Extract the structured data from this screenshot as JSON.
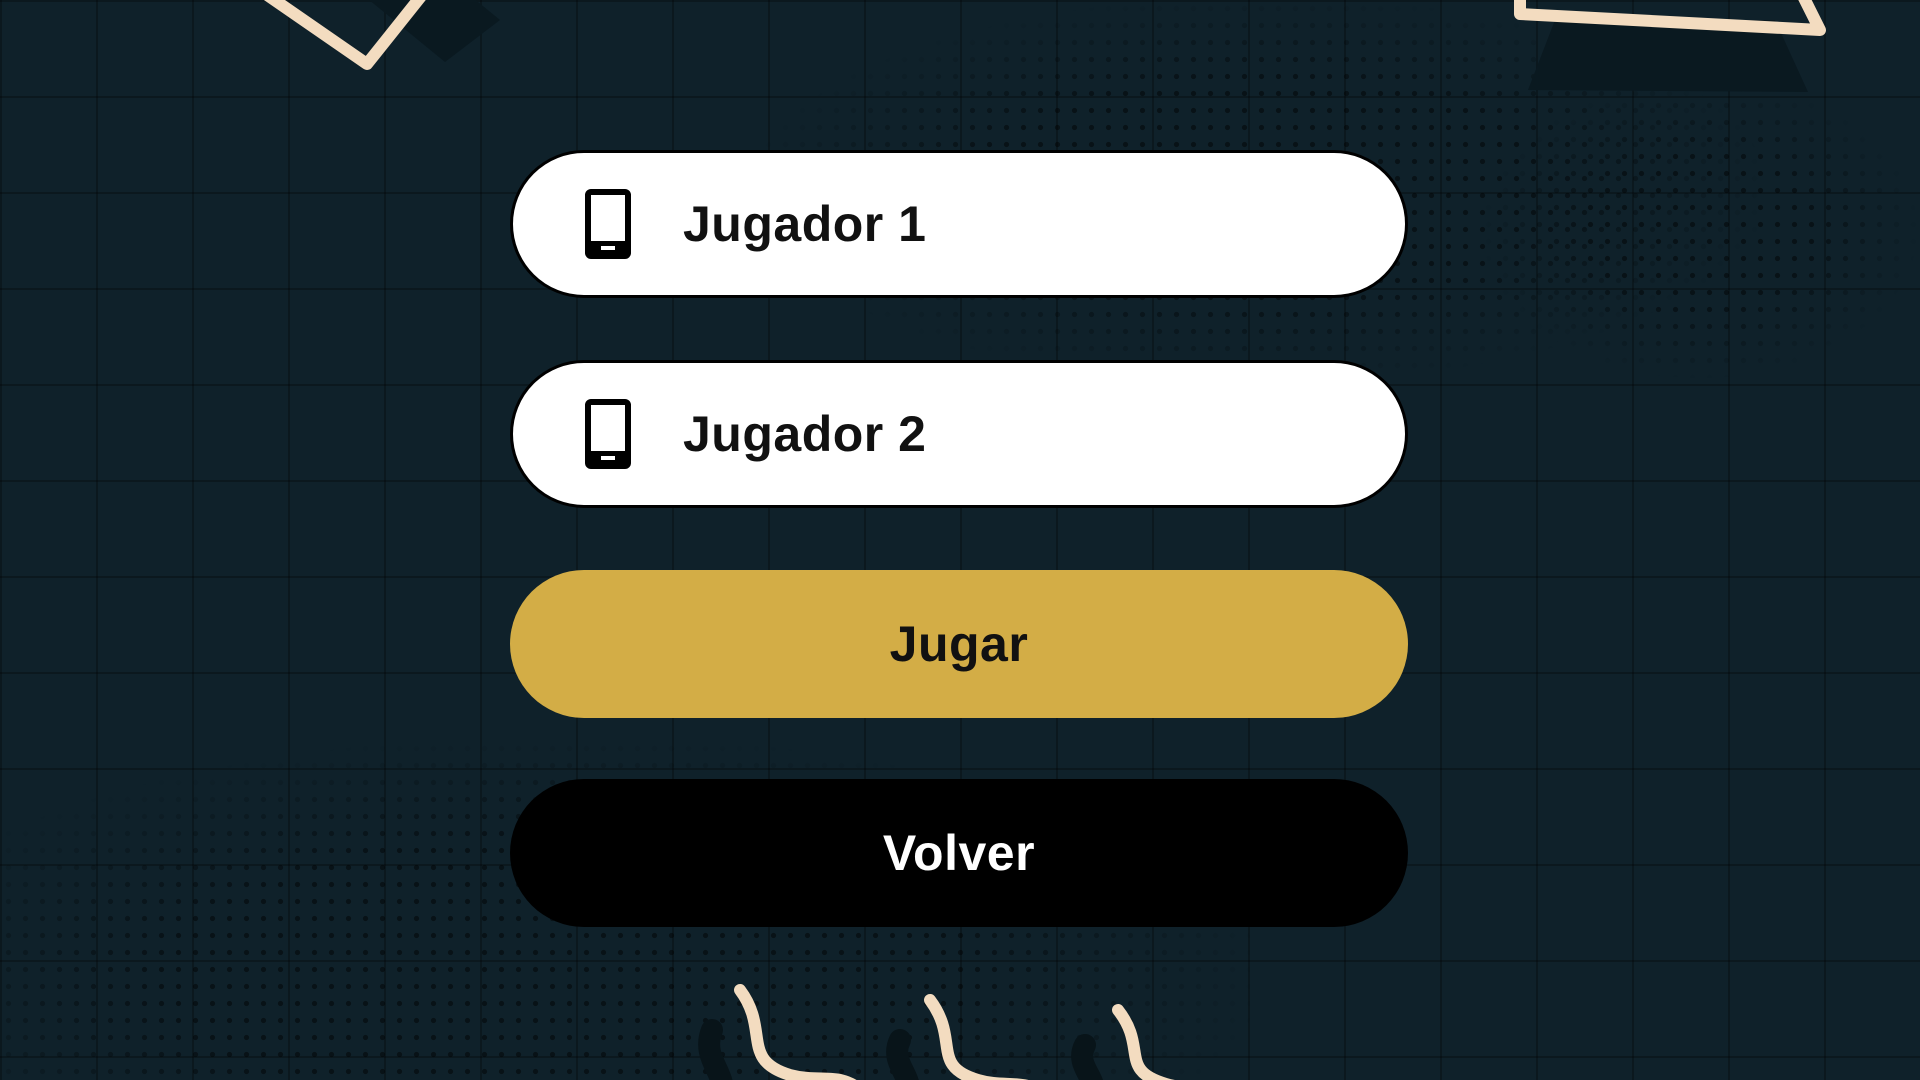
{
  "players": [
    {
      "label": "Jugador 1",
      "icon": "smartphone-icon"
    },
    {
      "label": "Jugador 2",
      "icon": "smartphone-icon"
    }
  ],
  "actions": {
    "play_label": "Jugar",
    "back_label": "Volver"
  },
  "colors": {
    "background": "#0f212a",
    "play_button": "#d3ad46",
    "back_button": "#000000",
    "player_field": "#ffffff",
    "decoration": "#f3dcc0"
  }
}
